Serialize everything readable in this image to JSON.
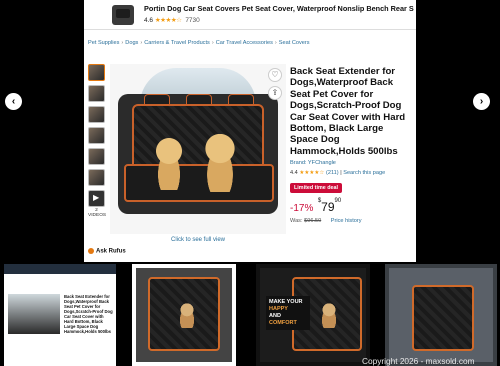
{
  "listing": {
    "top_title": "Portin Dog Car Seat Covers Pet Seat Cover, Waterproof Nonslip Bench Rear Seat Cove",
    "top_rating": "4.6",
    "top_stars": "★★★★☆",
    "top_review_count": "7730",
    "breadcrumbs": [
      "Pet Supplies",
      "Dogs",
      "Carriers & Travel Products",
      "Car Travel Accessories",
      "Seat Covers"
    ],
    "breadcrumb_sep": "›",
    "video_label": "2 VIDEOS",
    "full_view_link": "Click to see full view",
    "product_title": "Back Seat Extender for Dogs,Waterproof Back Seat Pet Cover for Dogs,Scratch-Proof Dog Car Seat Cover with Hard Bottom, Black Large Space Dog Hammock,Holds 500lbs",
    "brand": "Brand: YFChangle",
    "rating": "4.4",
    "stars": "★★★★☆",
    "review_count": "(211)",
    "search_link": "Search this page",
    "deal_badge": "Limited time deal",
    "discount": "-17%",
    "currency": "$",
    "price_whole": "79",
    "price_fraction": "90",
    "was_label": "Was:",
    "was_price": "$96.50",
    "price_history_link": "Price history",
    "ask_rufus": "Ask Rufus"
  },
  "thumbnails": {
    "first_title": "Back Seat Extender for Dogs,Waterproof Back Seat Pet Cover for Dogs,Scratch-Proof Dog Car Seat Cover with Hard Bottom, Black Large Space Dog Hammock,Holds 500lbs",
    "third_text_1": "MAKE YOUR",
    "third_text_2": "HAPPY",
    "third_text_3": "AND",
    "third_text_4": "COMFORT"
  },
  "nav": {
    "prev_icon": "‹",
    "next_icon": "›"
  },
  "watermark": "Copyright 2026 - maxsold.com",
  "colors": {
    "deal_red": "#cc0c39",
    "link_blue": "#2a6f9a",
    "star_orange": "#f39c12",
    "trim_orange": "#c9612a"
  }
}
